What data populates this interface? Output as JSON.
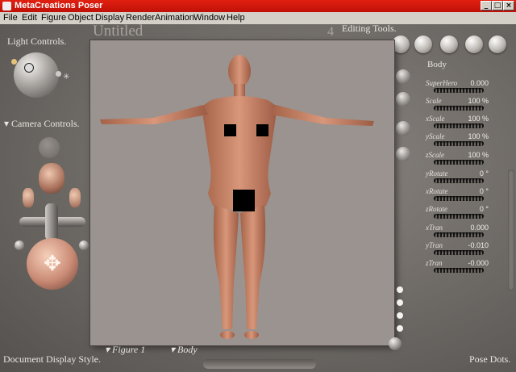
{
  "window": {
    "title": "MetaCreations Poser"
  },
  "menu": [
    "File",
    "Edit",
    "Figure",
    "Object",
    "Display",
    "Render",
    "Animation",
    "Window",
    "Help"
  ],
  "document": {
    "title": "Untitled",
    "counter": "4"
  },
  "panels": {
    "light_controls": "Light Controls.",
    "camera_controls": "Camera Controls.",
    "editing_tools": "Editing Tools.",
    "document_display_style": "Document Display Style.",
    "pose_dots": "Pose Dots."
  },
  "selectors": {
    "figure": "Figure 1",
    "body": "Body"
  },
  "parameters": {
    "header": "Body",
    "items": [
      {
        "name": "SuperHero",
        "value": "0.000"
      },
      {
        "name": "Scale",
        "value": "100 %"
      },
      {
        "name": "xScale",
        "value": "100 %"
      },
      {
        "name": "yScale",
        "value": "100 %"
      },
      {
        "name": "zScale",
        "value": "100 %"
      },
      {
        "name": "yRotate",
        "value": "0 °"
      },
      {
        "name": "xRotate",
        "value": "0 °"
      },
      {
        "name": "zRotate",
        "value": "0 °"
      },
      {
        "name": "xTran",
        "value": "0.000"
      },
      {
        "name": "yTran",
        "value": "-0.010"
      },
      {
        "name": "zTran",
        "value": "-0.000"
      }
    ]
  },
  "colors": {
    "titlebar": "#c01008",
    "canvas": "#9a938f",
    "skin": "#c98462"
  }
}
